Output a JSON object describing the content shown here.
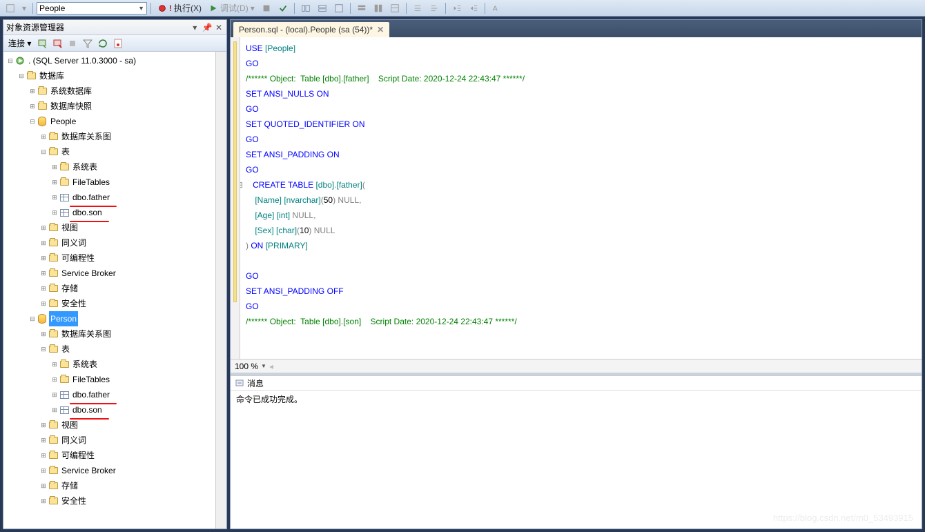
{
  "toolbar": {
    "combo_value": "People",
    "exec": "执行(X)",
    "debug": "调试(D)"
  },
  "object_explorer": {
    "title": "对象资源管理器",
    "connect_label": "连接 ▾",
    "root": ". (SQL Server 11.0.3000 - sa)",
    "databases": "数据库",
    "system_db": "系统数据库",
    "db_snapshot": "数据库快照",
    "people": "People",
    "db_diagrams": "数据库关系图",
    "tables": "表",
    "sys_tables": "系统表",
    "file_tables": "FileTables",
    "tbl_father": "dbo.father",
    "tbl_son": "dbo.son",
    "views": "视图",
    "synonyms": "同义词",
    "programmability": "可编程性",
    "service_broker": "Service Broker",
    "storage": "存储",
    "security": "安全性",
    "person": "Person"
  },
  "editor": {
    "tab_title": "Person.sql - (local).People (sa (54))*",
    "zoom": "100 %",
    "code": {
      "l1a": "USE ",
      "l1b": "[People]",
      "l2": "GO",
      "l3": "/****** Object:  Table [dbo].[father]    Script Date: 2020-12-24 22:43:47 ******/",
      "l4a": "SET ",
      "l4b": "ANSI_NULLS ",
      "l4c": "ON",
      "l5": "GO",
      "l6a": "SET ",
      "l6b": "QUOTED_IDENTIFIER ",
      "l6c": "ON",
      "l7": "GO",
      "l8a": "SET ",
      "l8b": "ANSI_PADDING ",
      "l8c": "ON",
      "l9": "GO",
      "l10a": "CREATE ",
      "l10b": "TABLE ",
      "l10c": "[dbo]",
      "l10d": ".",
      "l10e": "[father]",
      "l10f": "(",
      "l11a": "    [Name] [nvarchar]",
      "l11b": "(",
      "l11c": "50",
      "l11d": ") ",
      "l11e": "NULL",
      "l11f": ",",
      "l12a": "    [Age] [int] ",
      "l12b": "NULL",
      "l12c": ",",
      "l13a": "    [Sex] [char]",
      "l13b": "(",
      "l13c": "10",
      "l13d": ") ",
      "l13e": "NULL",
      "l14a": ") ",
      "l14b": "ON ",
      "l14c": "[PRIMARY]",
      "l15": "",
      "l16": "GO",
      "l17a": "SET ",
      "l17b": "ANSI_PADDING ",
      "l17c": "OFF",
      "l18": "GO",
      "l19": "/****** Object:  Table [dbo].[son]    Script Date: 2020-12-24 22:43:47 ******/"
    }
  },
  "messages": {
    "tab": "消息",
    "text": "命令已成功完成。"
  },
  "watermark": "https://blog.csdn.net/m0_53493915"
}
